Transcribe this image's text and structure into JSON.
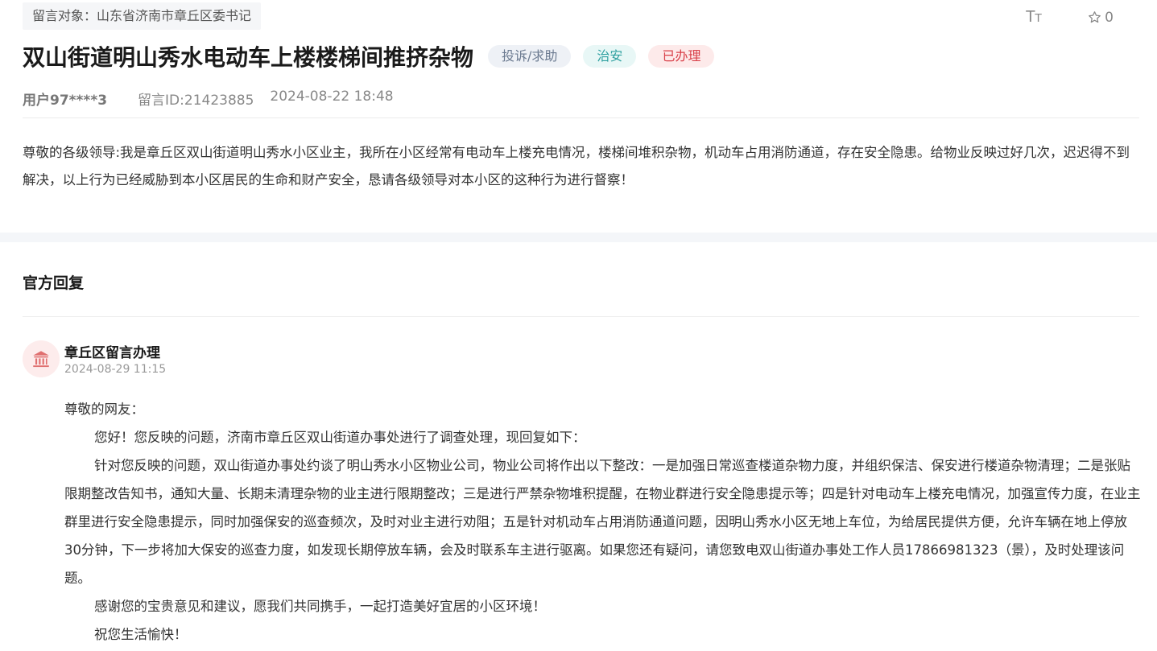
{
  "message": {
    "target_label": "留言对象：山东省济南市章丘区委书记",
    "title": "双山街道明山秀水电动车上楼楼梯间推挤杂物",
    "tags": [
      {
        "label": "投诉/求助",
        "bg": "#eef1f6",
        "color": "#6b7a90"
      },
      {
        "label": "治安",
        "bg": "#e8f7f6",
        "color": "#2fa0a0"
      },
      {
        "label": "已办理",
        "bg": "#fdeaea",
        "color": "#d9414a"
      }
    ],
    "user": "用户97****3",
    "message_id": "留言ID:21423885",
    "date": "2024-08-22 18:48",
    "content": "尊敬的各级领导:我是章丘区双山街道明山秀水小区业主，我所在小区经常有电动车上楼充电情况，楼梯间堆积杂物，机动车占用消防通道，存在安全隐患。给物业反映过好几次，迟迟得不到解决，以上行为已经威胁到本小区居民的生命和财产安全，恳请各级领导对本小区的这种行为进行督察！"
  },
  "tools": {
    "font_size_icon": "font-size-icon",
    "favorite_icon": "star-outline-icon",
    "favorite_count": "0"
  },
  "reply": {
    "section_title": "官方回复",
    "department": "章丘区留言办理",
    "avatar_icon": "government-building-icon",
    "time": "2024-08-29 11:15",
    "paragraphs": [
      "尊敬的网友：",
      "您好！您反映的问题，济南市章丘区双山街道办事处进行了调查处理，现回复如下：",
      "针对您反映的问题，双山街道办事处约谈了明山秀水小区物业公司，物业公司将作出以下整改：一是加强日常巡查楼道杂物力度，并组织保洁、保安进行楼道杂物清理；二是张贴限期整改告知书，通知大量、长期未清理杂物的业主进行限期整改；三是进行严禁杂物堆积提醒，在物业群进行安全隐患提示等；四是针对电动车上楼充电情况，加强宣传力度，在业主群里进行安全隐患提示，同时加强保安的巡查频次，及时对业主进行劝阻；五是针对机动车占用消防通道问题，因明山秀水小区无地上车位，为给居民提供方便，允许车辆在地上停放30分钟，下一步将加大保安的巡查力度，如发现长期停放车辆，会及时联系车主进行驱离。如果您还有疑问，请您致电双山街道办事处工作人员17866981323（景），及时处理该问题。",
      "感谢您的宝贵意见和建议，愿我们共同携手，一起打造美好宜居的小区环境！",
      "祝您生活愉快！"
    ]
  }
}
